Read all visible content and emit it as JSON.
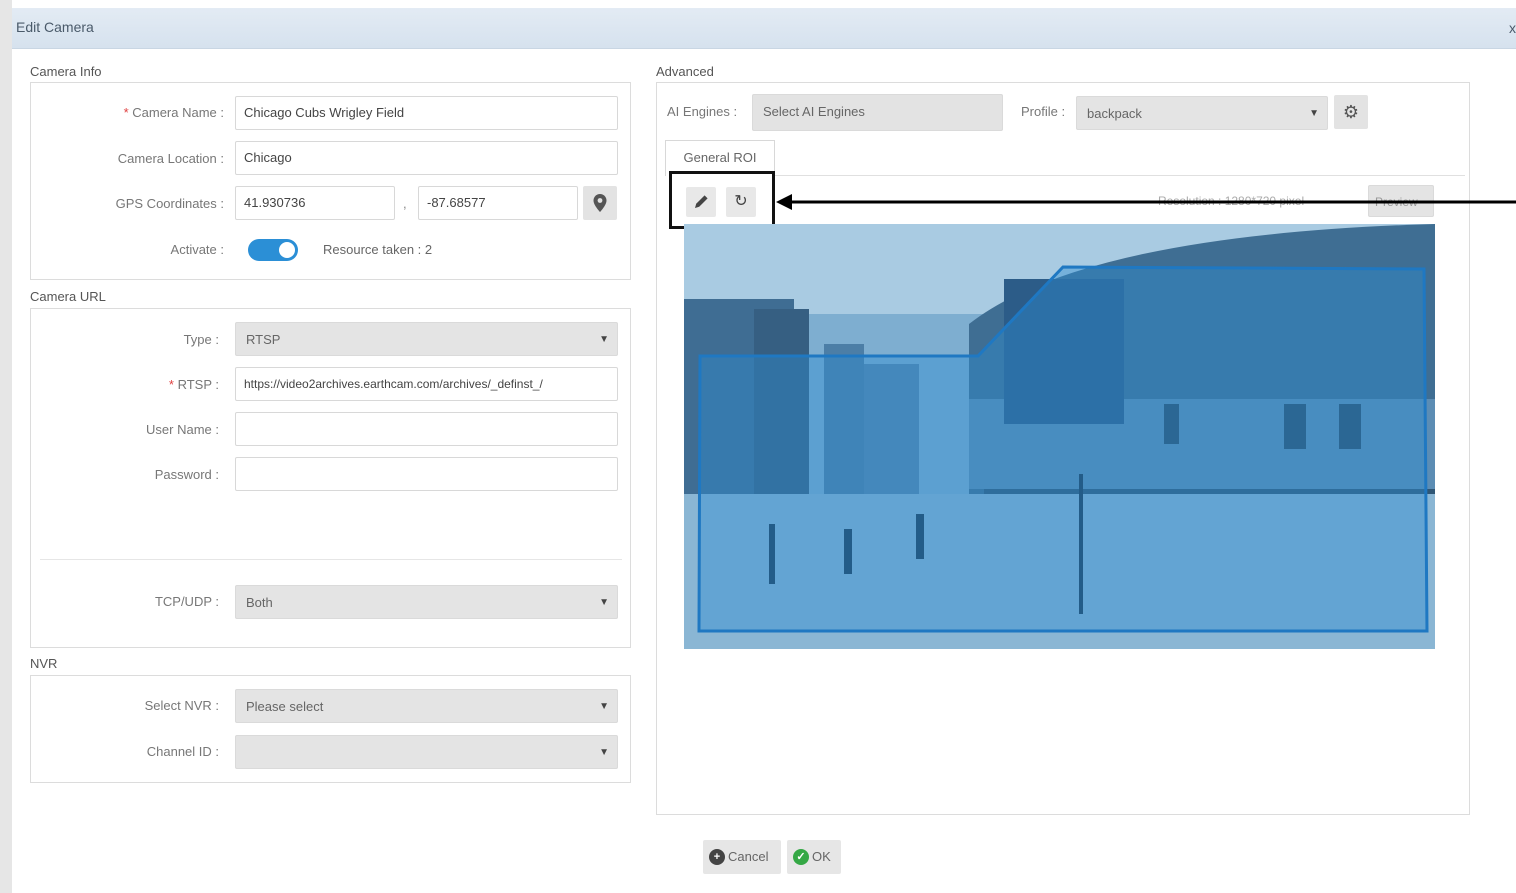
{
  "window": {
    "title": "Edit Camera",
    "close_glyph": "x"
  },
  "camera_info": {
    "section_label": "Camera Info",
    "name_label": "Camera Name :",
    "name_value": "Chicago Cubs Wrigley Field",
    "location_label": "Camera Location :",
    "location_value": "Chicago",
    "gps_label": "GPS Coordinates :",
    "gps_lat": "41.930736",
    "gps_sep": ",",
    "gps_lon": "-87.68577",
    "activate_label": "Activate :",
    "activate_on": true,
    "resource_text": "Resource taken : 2"
  },
  "camera_url": {
    "section_label": "Camera URL",
    "type_label": "Type :",
    "type_value": "RTSP",
    "rtsp_label": "RTSP :",
    "rtsp_value": "https://video2archives.earthcam.com/archives/_definst_/",
    "user_label": "User Name :",
    "user_value": "",
    "password_label": "Password :",
    "password_value": "",
    "protocol_label": "TCP/UDP :",
    "protocol_value": "Both"
  },
  "nvr": {
    "section_label": "NVR",
    "select_label": "Select NVR :",
    "select_value": "Please select",
    "channel_label": "Channel ID :",
    "channel_value": ""
  },
  "advanced": {
    "section_label": "Advanced",
    "engines_label": "AI Engines :",
    "engines_placeholder": "Select AI Engines",
    "profile_label": "Profile :",
    "profile_value": "backpack",
    "tab_label": "General ROI",
    "resolution_text": "Resolution : 1280*720 pixel",
    "preview_label": "Preview"
  },
  "footer": {
    "cancel_label": "Cancel",
    "ok_label": "OK"
  },
  "colors": {
    "accent": "#2b8fd6",
    "ok_green": "#35a845",
    "roi_stroke": "#1f78c2",
    "required": "#e04040"
  },
  "icons": [
    "pencil-icon",
    "refresh-icon",
    "gear-icon",
    "map-pin-icon",
    "chevron-down-icon",
    "plus-circle-icon",
    "check-circle-icon",
    "arrow-left-icon"
  ]
}
